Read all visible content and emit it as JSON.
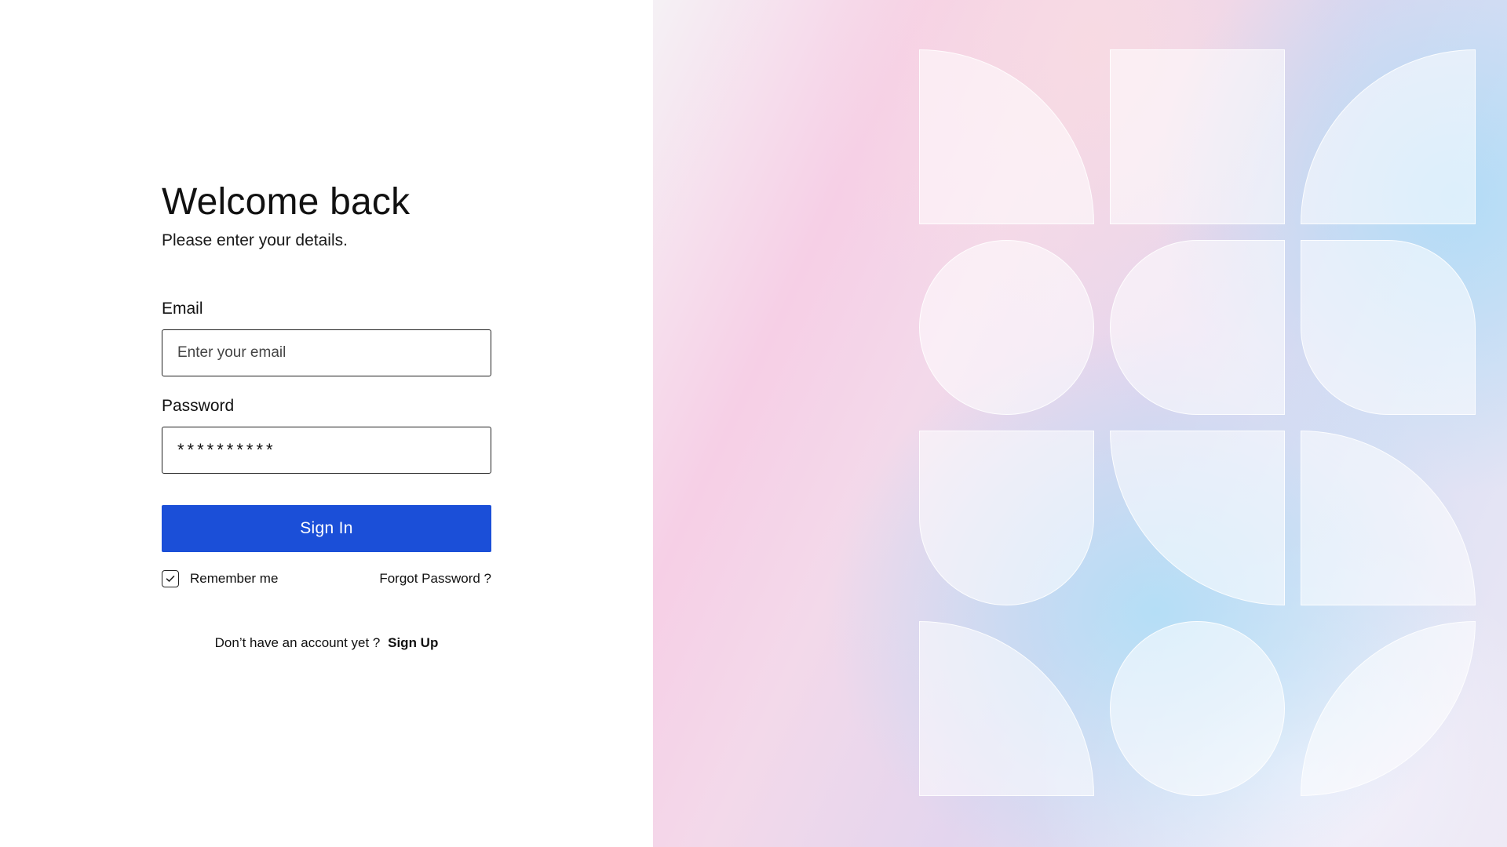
{
  "login": {
    "title": "Welcome back",
    "subtitle": "Please enter your details.",
    "email": {
      "label": "Email",
      "placeholder": "Enter your email",
      "value": ""
    },
    "password": {
      "label": "Password",
      "display_value": "**********"
    },
    "sign_in_label": "Sign In",
    "remember_me": {
      "label": "Remember me",
      "checked": true,
      "icon": "checkbox-checked-icon"
    },
    "forgot_password_label": "Forgot Password ?",
    "signup_prompt": "Don’t have an account yet ?",
    "signup_link_label": "Sign Up"
  },
  "colors": {
    "primary_button": "#1b4fd8",
    "text": "#111111",
    "background": "#ffffff"
  },
  "decoration": {
    "pattern": "geometric-shape-grid",
    "tiles": [
      "quarter-circle",
      "square",
      "quarter-circle",
      "circle",
      "half-rounded",
      "leaf",
      "half-rounded",
      "quarter-circle",
      "quarter-circle",
      "quarter-circle",
      "circle",
      "quarter-circle"
    ]
  }
}
